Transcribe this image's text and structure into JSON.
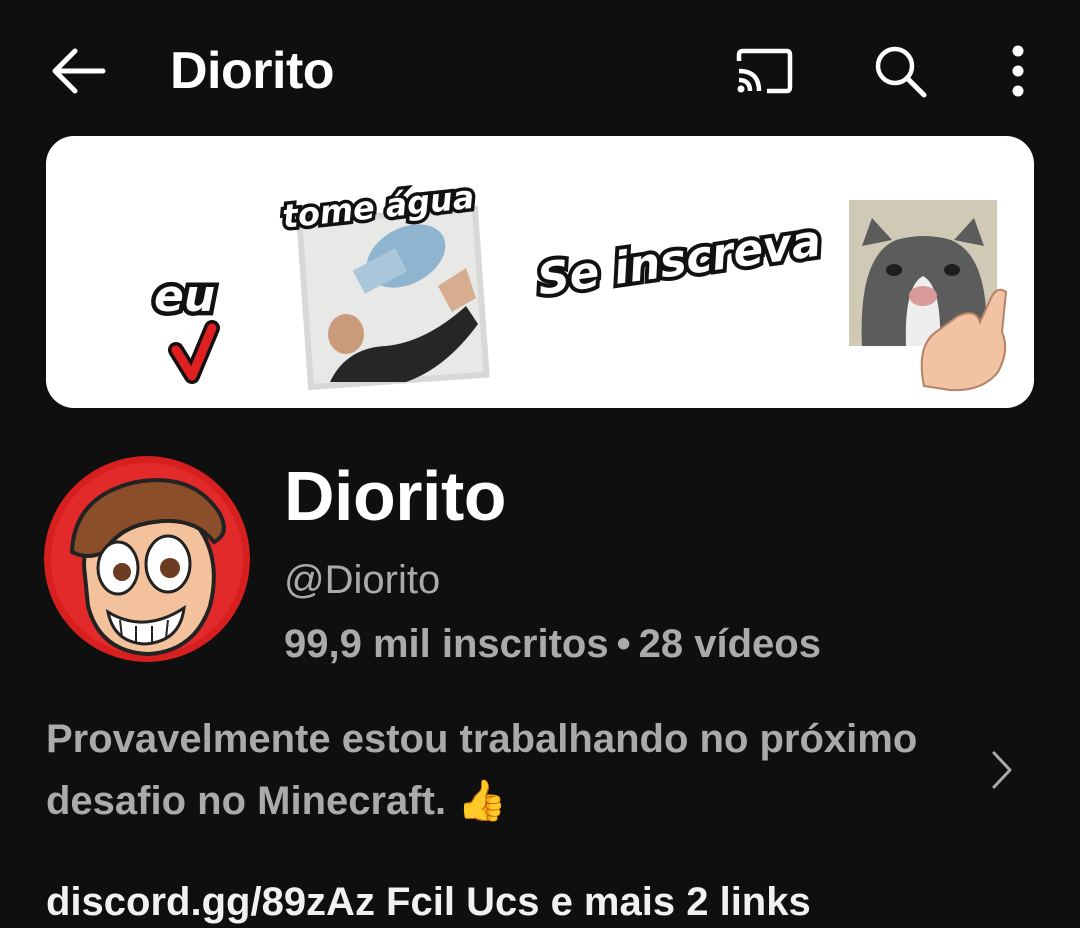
{
  "appbar": {
    "title": "Diorito",
    "icons": [
      "back-arrow-icon",
      "cast-icon",
      "search-icon",
      "more-vert-icon"
    ]
  },
  "banner": {
    "texts": {
      "eu": "eu",
      "tome_agua": "tome água",
      "se_inscreva": "Se inscreva"
    }
  },
  "channel": {
    "name": "Diorito",
    "handle": "@Diorito",
    "subscribers": "99,9 mil inscritos",
    "separator": "•",
    "videos": "28 vídeos"
  },
  "description": {
    "text": "Provavelmente estou trabalhando no próximo desafio no Minecraft. 👍"
  },
  "links": {
    "text": "discord.gg/89zAz Fcil  Ucs  e mais 2 links"
  },
  "colors": {
    "background": "#0f0f0f",
    "primary_text": "#ffffff",
    "secondary_text": "#aaaaaa",
    "banner_bg": "#ffffff",
    "avatar_red": "#d81f1f"
  }
}
